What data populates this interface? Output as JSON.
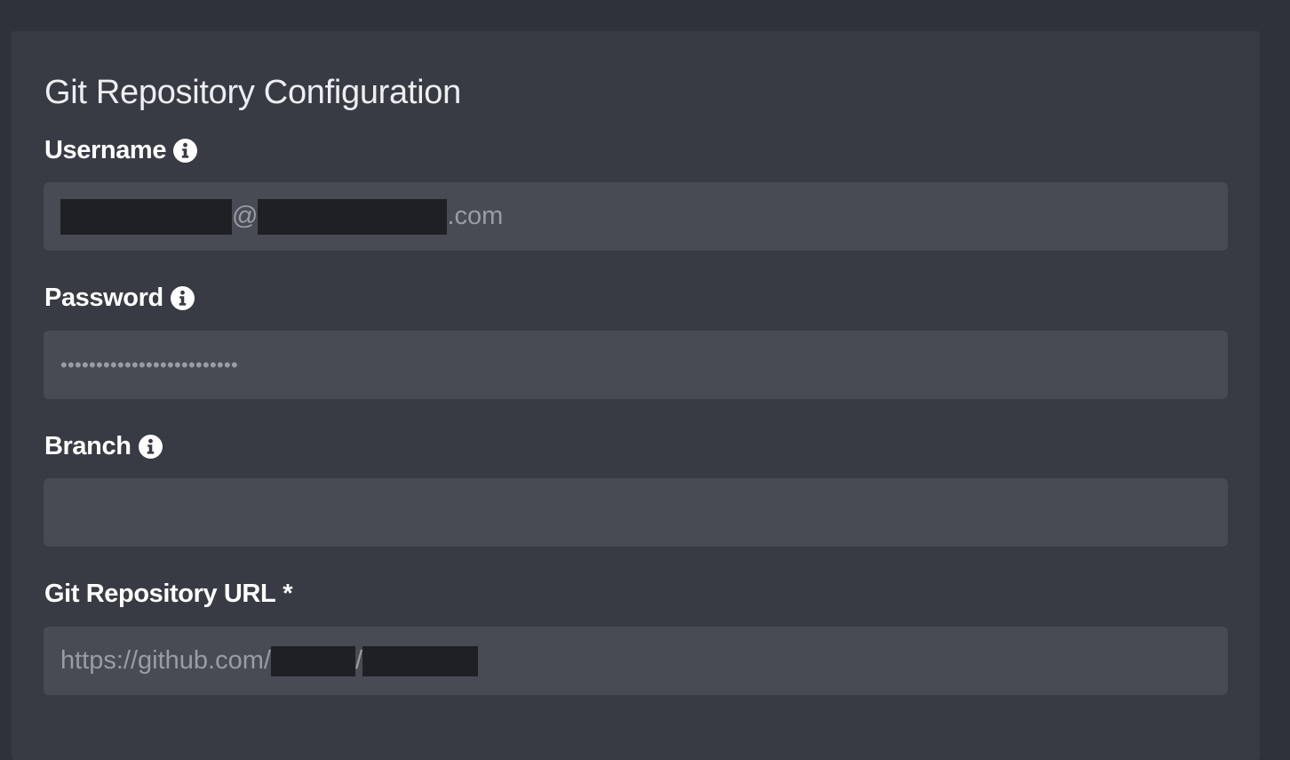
{
  "form": {
    "title": "Git Repository Configuration",
    "username": {
      "label": "Username",
      "value_separator": "@",
      "value_suffix": ".com"
    },
    "password": {
      "label": "Password",
      "masked_value": "•••••••••••••••••••••••••"
    },
    "branch": {
      "label": "Branch",
      "value": ""
    },
    "repo_url": {
      "label": "Git Repository URL",
      "required_marker": "*",
      "value_prefix": "https://github.com/",
      "value_separator": "/"
    }
  },
  "icons": {
    "info": "info-circle-icon"
  },
  "colors": {
    "background": "#30323b",
    "panel": "#393b44",
    "input": "#494b54",
    "redaction": "#1f2026"
  }
}
